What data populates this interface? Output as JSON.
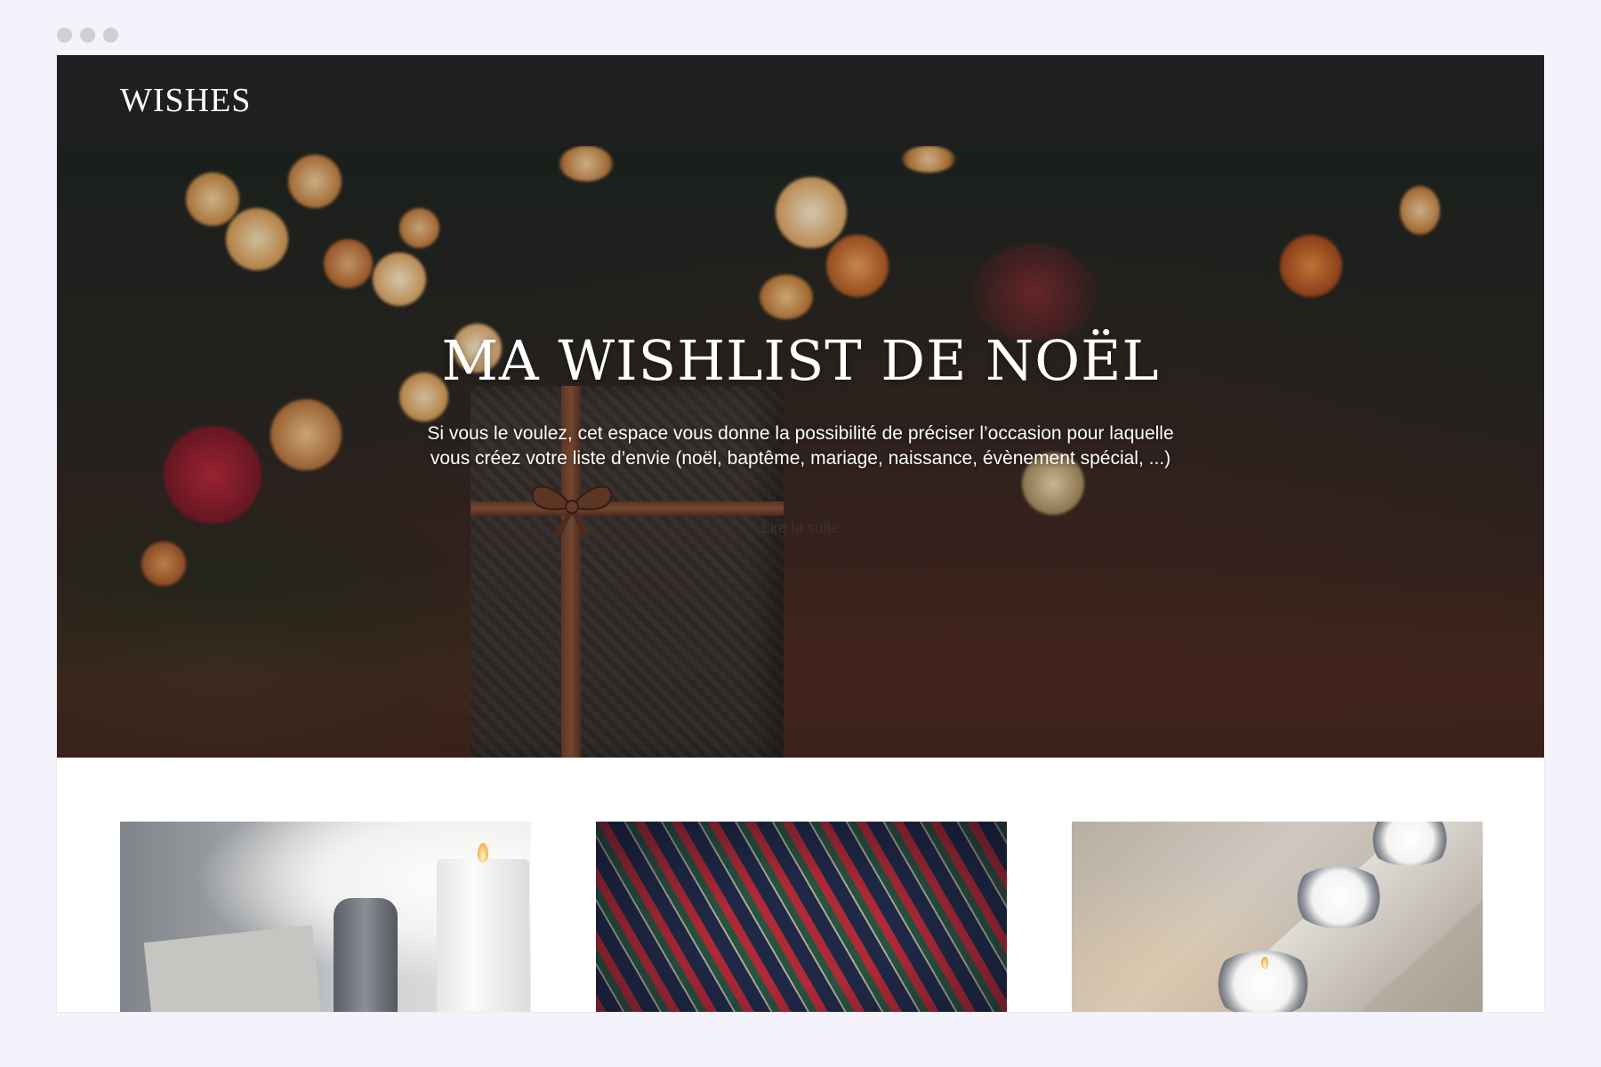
{
  "site": {
    "logo": "WISHES"
  },
  "hero": {
    "title": "MA WISHLIST DE NOËL",
    "description": "Si vous le voulez, cet espace vous donne la possibilité de préciser l’occasion pour laquelle vous créez votre liste d’envie (noël, baptême, mariage, naissance, évènement spécial, ...)",
    "link_label": "Lire la suite"
  },
  "cards": [
    {
      "image": "candles-and-vase"
    },
    {
      "image": "tartan-ribbon"
    },
    {
      "image": "tealight-candles"
    }
  ],
  "colors": {
    "header_bg": "#1f1f21",
    "page_bg": "#f4f3fb",
    "text_on_dark": "#ffffff"
  }
}
